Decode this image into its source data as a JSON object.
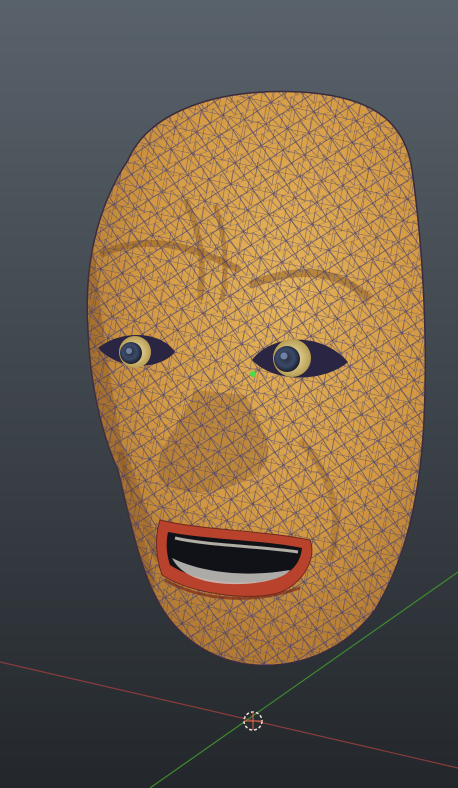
{
  "viewport": {
    "object": "noh-mask-mesh",
    "display_mode": "wireframe-on-shaded",
    "show_grid_axes": true,
    "colors": {
      "background_top": "#59626b",
      "background_bottom": "#23272b",
      "skin": "#d49a43",
      "skin_highlight": "#e6b45a",
      "skin_shadow": "#a56d2c",
      "wire": "#3d3a73",
      "x_axis": "#8a3b3b",
      "z_axis": "#3f8a2e",
      "lips": "#b8422c",
      "pivot": "#f2e0d6",
      "selected_vertex": "#4bdc4b"
    }
  }
}
